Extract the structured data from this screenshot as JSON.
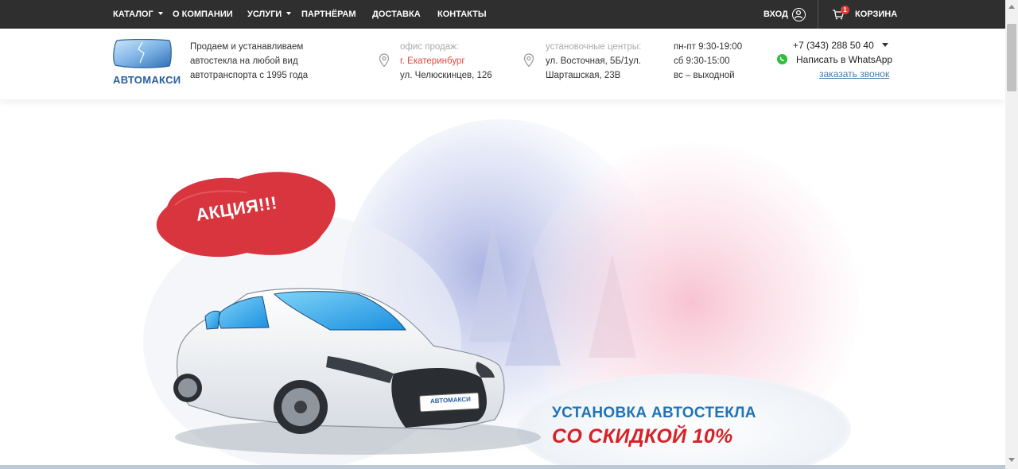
{
  "topnav": {
    "items": [
      {
        "label": "КАТАЛОГ",
        "has_dropdown": true
      },
      {
        "label": "О КОМПАНИИ",
        "has_dropdown": false
      },
      {
        "label": "УСЛУГИ",
        "has_dropdown": true
      },
      {
        "label": "ПАРТНЁРАМ",
        "has_dropdown": false
      },
      {
        "label": "ДОСТАВКА",
        "has_dropdown": false
      },
      {
        "label": "КОНТАКТЫ",
        "has_dropdown": false
      }
    ],
    "login_label": "ВХОД",
    "cart_label": "КОРЗИНА",
    "cart_count": "1"
  },
  "header": {
    "logo_text": "АВТОМАКСИ",
    "tagline": [
      "Продаем и устанавливаем",
      "автостекла на любой вид",
      "автотранспорта с 1995 года"
    ],
    "office": {
      "title": "офис продаж:",
      "city": "г. Екатеринбург",
      "address": "ул. Челюскинцев, 126"
    },
    "centers": {
      "title": "установочные центры:",
      "line1": "ул. Восточная, 5Б/1ул.",
      "line2": "Шарташская, 23В"
    },
    "hours": [
      "пн-пт 9:30-19:00",
      "сб 9:30-15:00",
      "вс – выходной"
    ],
    "phone": "+7 (343) 288 50 40",
    "whatsapp_label": "Написать в WhatsApp",
    "callback_label": "заказать звонок"
  },
  "banner": {
    "promo_badge": "АКЦИЯ!!!",
    "plate_text": "АВТОМАКСИ",
    "headline_line1": "УСТАНОВКА АВТОСТЕКЛА",
    "headline_line2": "СО СКИДКОЙ 10%"
  },
  "colors": {
    "nav_bg": "#2f2f2f",
    "brand_blue": "#2a5e9e",
    "accent_red": "#e3483f",
    "promo_blue": "#1f73b8",
    "promo_red": "#d62228",
    "whatsapp_green": "#2fbe3c"
  }
}
